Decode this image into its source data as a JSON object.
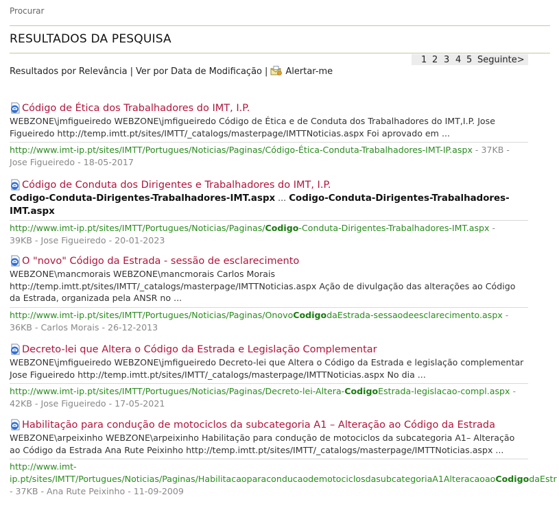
{
  "breadcrumb": "Procurar",
  "page_title": "RESULTADOS DA PESQUISA",
  "pager": {
    "pages": [
      "1",
      "2",
      "3",
      "4",
      "5"
    ],
    "next": "Seguinte>"
  },
  "sort": {
    "relevance": "Resultados por Relevância",
    "separator": "|",
    "by_date": "Ver por Data de Modificação",
    "alert": "Alertar-me"
  },
  "results": [
    {
      "title": "Código de Ética dos Trabalhadores do IMT, I.P.",
      "desc_line1": "WEBZONE\\jmfigueiredo WEBZONE\\jmfigueiredo Código de Ética e de Conduta dos Trabalhadores do IMT,I.P. Jose",
      "desc_line2": "Figueiredo http://temp.imtt.pt/sites/IMTT/_catalogs/masterpage/IMTTNoticias.aspx Foi aprovado em ...",
      "url": "http://www.imt-ip.pt/sites/IMTT/Portugues/Noticias/Paginas/Código-Ética-Conduta-Trabalhadores-IMT-IP.aspx",
      "url_suffix": " - 37KB -",
      "meta": "Jose Figueiredo - 18-05-2017"
    },
    {
      "title": "Código de Conduta dos Dirigentes e Trabalhadores do IMT, I.P.",
      "desc_bold1": "Codigo-Conduta-Dirigentes-Trabalhadores-IMT.aspx",
      "desc_mid": " ... ",
      "desc_bold2": "Codigo-Conduta-Dirigentes-Trabalhadores-",
      "desc_bold3": "IMT.aspx",
      "url_pre": "http://www.imt-ip.pt/sites/IMTT/Portugues/Noticias/Paginas/",
      "url_hl": "Codigo",
      "url_post": "-Conduta-Dirigentes-Trabalhadores-IMT.aspx",
      "url_suffix": " -",
      "meta": "39KB - Jose Figueiredo - 20-01-2023"
    },
    {
      "title": "O \"novo\" Código da Estrada - sessão de esclarecimento",
      "desc_line1": "WEBZONE\\mancmorais WEBZONE\\mancmorais Carlos Morais",
      "desc_line2": "http://temp.imtt.pt/sites/IMTT/_catalogs/masterpage/IMTTNoticias.aspx Ação de divulgação das alterações ao Código",
      "desc_line3": "da Estrada, organizada pela ANSR no ...",
      "url_pre": "http://www.imt-ip.pt/sites/IMTT/Portugues/Noticias/Paginas/Onovo",
      "url_hl": "Codigo",
      "url_post": "daEstrada-sessaodeesclarecimento.aspx",
      "url_suffix": " -",
      "meta": "36KB - Carlos Morais - 26-12-2013"
    },
    {
      "title": "Decreto-lei que Altera o Código da Estrada e Legislação Complementar",
      "desc_line1": "WEBZONE\\jmfigueiredo WEBZONE\\jmfigueiredo Decreto-lei que Altera o Código da Estrada e legislação complementar",
      "desc_line2": "Jose Figueiredo http://temp.imtt.pt/sites/IMTT/_catalogs/masterpage/IMTTNoticias.aspx No dia ...",
      "url_pre": "http://www.imt-ip.pt/sites/IMTT/Portugues/Noticias/Paginas/Decreto-lei-Altera-",
      "url_hl": "Codigo",
      "url_post": "Estrada-legislacao-compl.aspx",
      "url_suffix": " -",
      "meta": "42KB - Jose Figueiredo - 17-05-2021"
    },
    {
      "title": "Habilitação para condução de motociclos da subcategoria A1 – Alteração ao Código da Estrada",
      "desc_line1": "WEBZONE\\arpeixinho WEBZONE\\arpeixinho Habilitação para condução de motociclos da subcategoria A1– Alteração",
      "desc_line2": "ao Código da Estrada Ana Rute Peixinho http://temp.imtt.pt/sites/IMTT/_catalogs/masterpage/IMTTNoticias.aspx ...",
      "url_line1": "http://www.imt-",
      "url_pre": "ip.pt/sites/IMTT/Portugues/Noticias/Paginas/HabilitacaoparaconducaodemotociclosdasubcategoriaA1Alteracaoao",
      "url_hl": "Codigo",
      "url_post": "daEstr",
      "meta": "- 37KB - Ana Rute Peixinho - 11-09-2009"
    }
  ],
  "colors": {
    "title": "#b0153c",
    "url": "#2b8a1f",
    "meta": "#888888",
    "rule": "#c6c79a"
  },
  "icons": {
    "result": "document-icon",
    "alert": "alert-envelope-icon"
  }
}
